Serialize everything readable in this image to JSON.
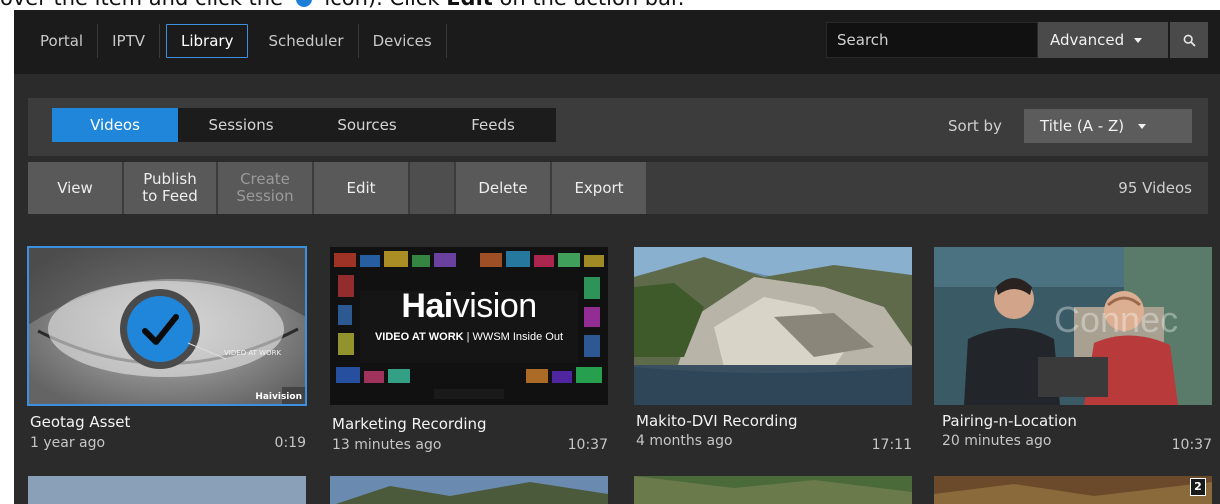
{
  "doc": {
    "caption_pre": "over the item and click the",
    "caption_mid": "icon). Click",
    "caption_bold": "Edit",
    "caption_post": "on the action bar."
  },
  "nav": {
    "items": [
      "Portal",
      "IPTV",
      "Library",
      "Scheduler",
      "Devices"
    ],
    "active": "Library"
  },
  "search": {
    "placeholder": "Search",
    "advanced_label": "Advanced"
  },
  "tabs": {
    "items": [
      "Videos",
      "Sessions",
      "Sources",
      "Feeds"
    ],
    "active": "Videos"
  },
  "sort": {
    "label": "Sort by",
    "value": "Title (A - Z)"
  },
  "actions": {
    "view": "View",
    "publish_1": "Publish",
    "publish_2": "to Feed",
    "create_1": "Create",
    "create_2": "Session",
    "edit": "Edit",
    "delete": "Delete",
    "export": "Export",
    "count": "95 Videos"
  },
  "videos": [
    {
      "title": "Geotag Asset",
      "age": "1 year ago",
      "duration": "0:19",
      "selected": true,
      "thumb_text": "VIDEO AT WORK",
      "thumb_brand": "Haivision"
    },
    {
      "title": "Marketing Recording",
      "age": "13 minutes ago",
      "duration": "10:37",
      "selected": false,
      "thumb_brand_a": "Hai",
      "thumb_brand_b": "vision",
      "thumb_sub_a": "VIDEO AT WORK",
      "thumb_sub_b": "| WWSM Inside Out"
    },
    {
      "title": "Makito-DVI Recording",
      "age": "4 months ago",
      "duration": "17:11",
      "selected": false
    },
    {
      "title": "Pairing-n-Location",
      "age": "20 minutes ago",
      "duration": "10:37",
      "selected": false,
      "thumb_text": "Connec"
    }
  ],
  "second_row_badge": "2",
  "colors": {
    "accent": "#1f86da",
    "topbar": "#1b1b1b",
    "panel": "#3c3c3c",
    "background": "#2b2b2b"
  }
}
